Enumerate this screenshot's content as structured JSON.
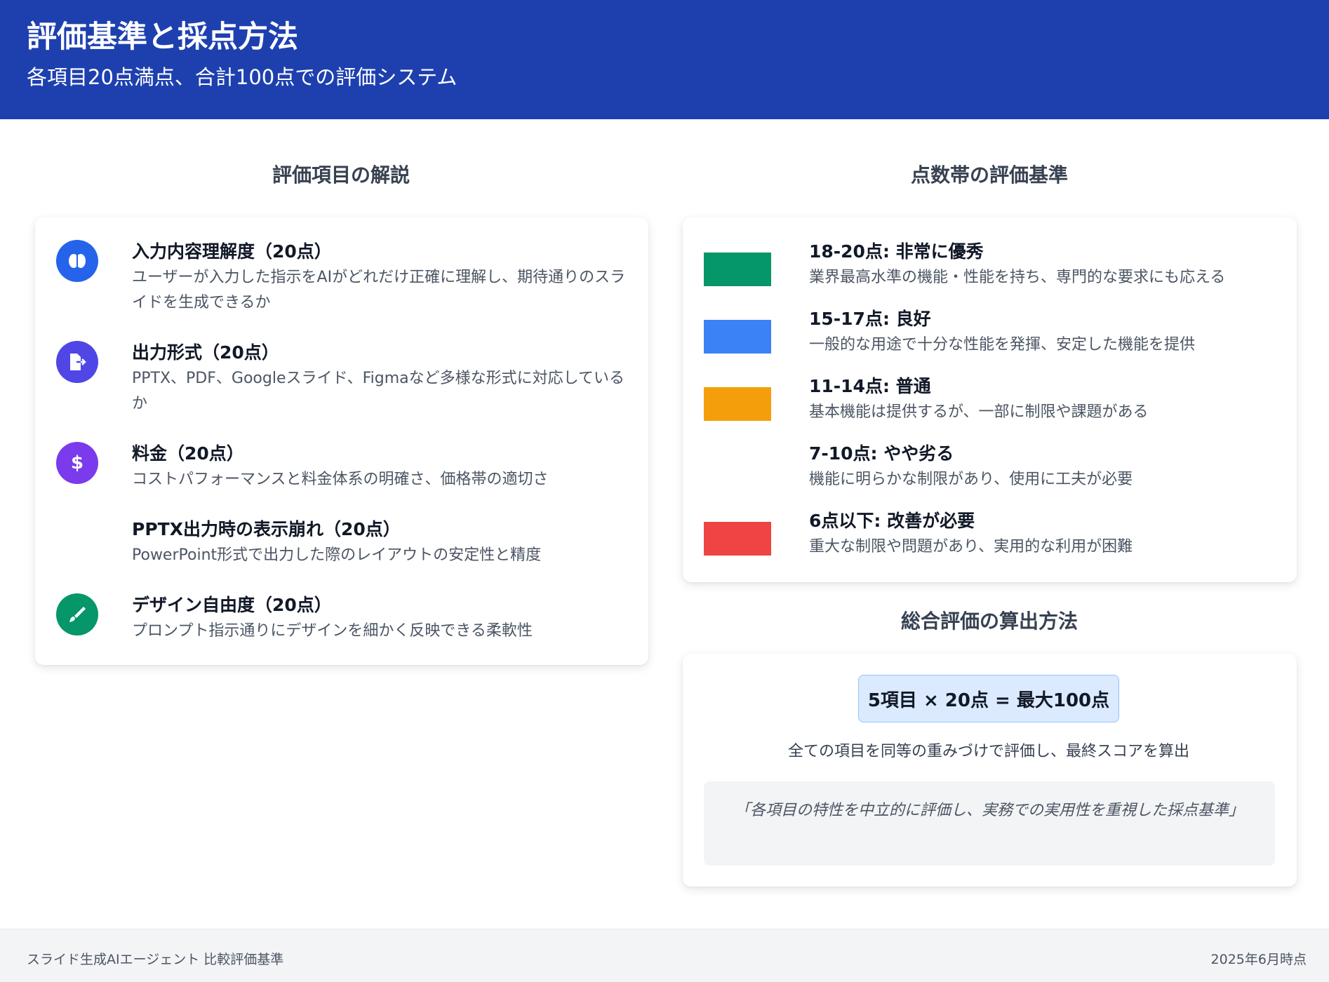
{
  "header": {
    "title": "評価基準と採点方法",
    "subtitle": "各項目20点満点、合計100点での評価システム"
  },
  "criteria_section": {
    "title": "評価項目の解説",
    "items": [
      {
        "icon": "brain-icon",
        "icon_color": "#2563eb",
        "title": "入力内容理解度（20点）",
        "desc": "ユーザーが入力した指示をAIがどれだけ正確に理解し、期待通りのスライドを生成できるか"
      },
      {
        "icon": "file-export-icon",
        "icon_color": "#4f46e5",
        "title": "出力形式（20点）",
        "desc": "PPTX、PDF、Googleスライド、Figmaなど多様な形式に対応しているか"
      },
      {
        "icon": "dollar-icon",
        "icon_color": "#7c3aed",
        "title": "料金（20点）",
        "desc": "コストパフォーマンスと料金体系の明確さ、価格帯の適切さ"
      },
      {
        "icon": "",
        "icon_color": "",
        "title": "PPTX出力時の表示崩れ（20点）",
        "desc": "PowerPoint形式で出力した際のレイアウトの安定性と精度"
      },
      {
        "icon": "paintbrush-icon",
        "icon_color": "#059669",
        "title": "デザイン自由度（20点）",
        "desc": "プロンプト指示通りにデザインを細かく反映できる柔軟性"
      }
    ]
  },
  "bands_section": {
    "title": "点数帯の評価基準",
    "items": [
      {
        "color": "#059669",
        "title": "18-20点: 非常に優秀",
        "desc": "業界最高水準の機能・性能を持ち、専門的な要求にも応える"
      },
      {
        "color": "#3b82f6",
        "title": "15-17点: 良好",
        "desc": "一般的な用途で十分な性能を発揮、安定した機能を提供"
      },
      {
        "color": "#f59e0b",
        "title": "11-14点: 普通",
        "desc": "基本機能は提供するが、一部に制限や課題がある"
      },
      {
        "color": "",
        "title": "7-10点: やや劣る",
        "desc": "機能に明らかな制限があり、使用に工夫が必要"
      },
      {
        "color": "#ef4444",
        "title": "6点以下: 改善が必要",
        "desc": "重大な制限や問題があり、実用的な利用が困難"
      }
    ]
  },
  "calc_section": {
    "title": "総合評価の算出方法",
    "formula": "5項目 × 20点 = 最大100点",
    "desc": "全ての項目を同等の重みづけで評価し、最終スコアを算出",
    "quote": "「各項目の特性を中立的に評価し、実務での実用性を重視した採点基準」"
  },
  "footer": {
    "left": "スライド生成AIエージェント 比較評価基準",
    "right": "2025年6月時点"
  }
}
